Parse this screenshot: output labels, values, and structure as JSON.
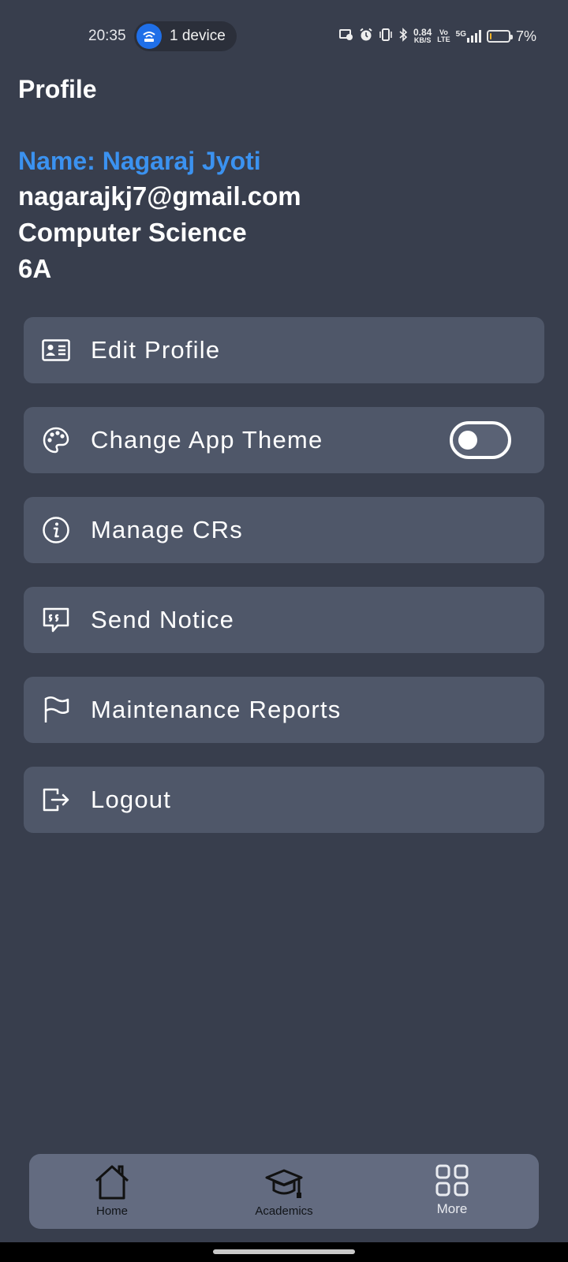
{
  "status_bar": {
    "time": "20:35",
    "hotspot_label": "1 device",
    "net_speed_value": "0.84",
    "net_speed_unit": "KB/S",
    "volte_top": "Vo",
    "volte_bottom": "LTE",
    "network_type": "5G",
    "battery_text": "7%",
    "battery_level": 0.07,
    "battery_color": "#f0b429"
  },
  "header": {
    "title": "Profile"
  },
  "profile": {
    "name": "Name: Nagaraj Jyoti",
    "email": "nagarajkj7@gmail.com",
    "department": "Computer Science",
    "section": "6A",
    "name_color": "#3b92f0"
  },
  "menu": {
    "items": [
      {
        "label": "Edit Profile",
        "icon": "id-card-icon"
      },
      {
        "label": "Change App Theme",
        "icon": "palette-icon",
        "toggle_on": false
      },
      {
        "label": "Manage CRs",
        "icon": "info-icon"
      },
      {
        "label": "Send Notice",
        "icon": "quote-bubble-icon"
      },
      {
        "label": "Maintenance Reports",
        "icon": "flag-icon"
      },
      {
        "label": "Logout",
        "icon": "logout-icon"
      }
    ]
  },
  "bottom_nav": {
    "items": [
      {
        "label": "Home",
        "icon": "home-icon"
      },
      {
        "label": "Academics",
        "icon": "graduation-cap-icon"
      },
      {
        "label": "More",
        "icon": "grid-icon"
      }
    ]
  },
  "colors": {
    "background": "#383e4d",
    "card": "#4f5769",
    "nav_bar": "#636b80",
    "accent": "#3b92f0"
  }
}
